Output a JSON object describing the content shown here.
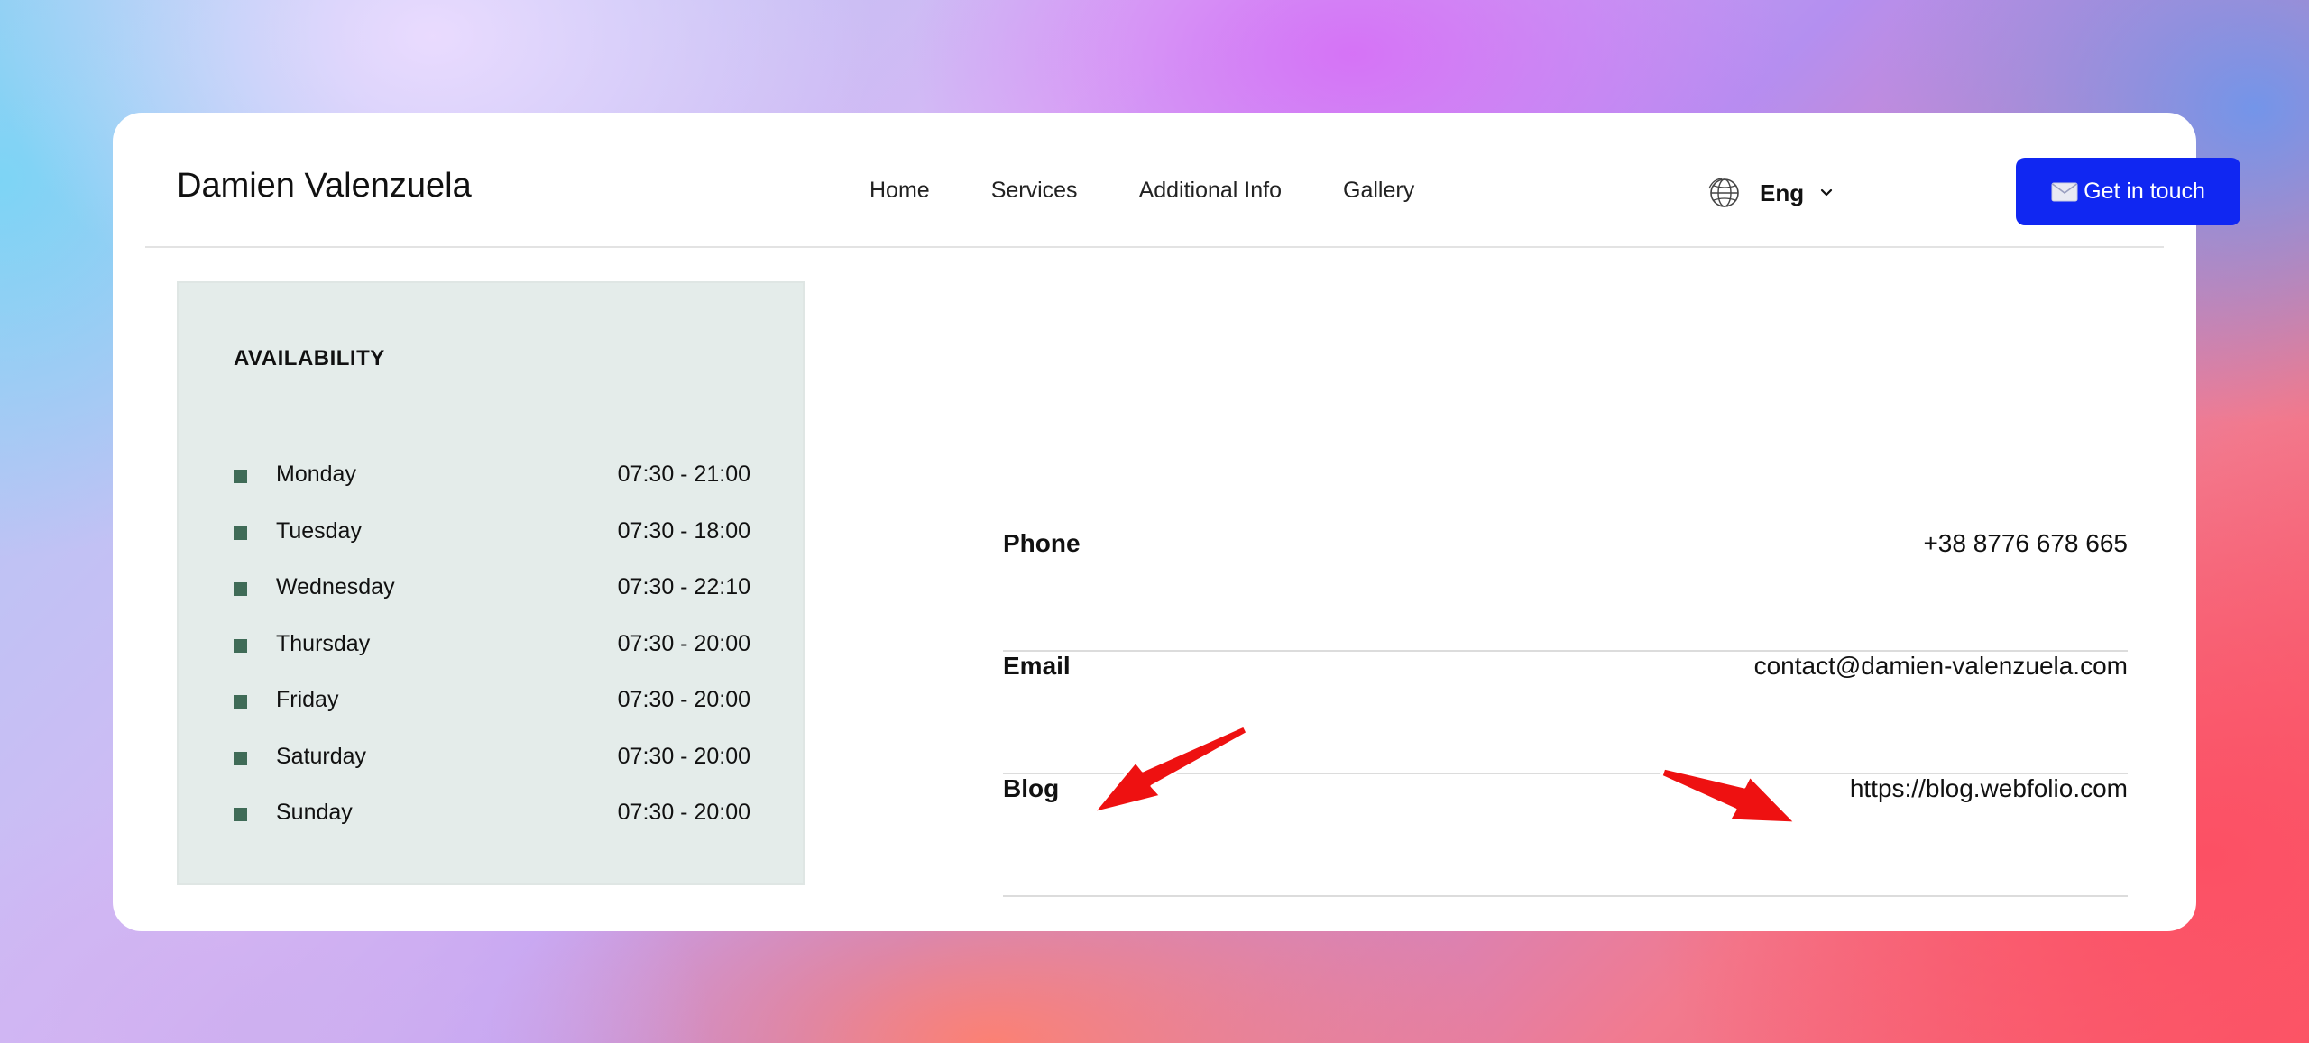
{
  "header": {
    "brand": "Damien Valenzuela",
    "nav": [
      "Home",
      "Services",
      "Additional Info",
      "Gallery"
    ],
    "language": {
      "icon": "globe-icon",
      "label": "Eng",
      "chevron": "chevron-down-icon"
    },
    "cta": {
      "icon": "envelope-icon",
      "label": "Get in touch",
      "color": "#1027f2"
    }
  },
  "availability": {
    "title": "AVAILABILITY",
    "bullet_color": "#3f6b57",
    "schedule": [
      {
        "day": "Monday",
        "hours": "07:30 - 21:00"
      },
      {
        "day": "Tuesday",
        "hours": "07:30 - 18:00"
      },
      {
        "day": "Wednesday",
        "hours": "07:30 - 22:10"
      },
      {
        "day": "Thursday",
        "hours": "07:30 - 20:00"
      },
      {
        "day": "Friday",
        "hours": "07:30 - 20:00"
      },
      {
        "day": "Saturday",
        "hours": "07:30 - 20:00"
      },
      {
        "day": "Sunday",
        "hours": "07:30 - 20:00"
      }
    ]
  },
  "contacts": [
    {
      "label": "Phone",
      "value": "+38 8776 678 665"
    },
    {
      "label": "Email",
      "value": "contact@damien-valenzuela.com"
    },
    {
      "label": "Blog",
      "value": "https://blog.webfolio.com"
    }
  ],
  "annotations": {
    "arrow_color": "#ee1111",
    "count": 2
  }
}
